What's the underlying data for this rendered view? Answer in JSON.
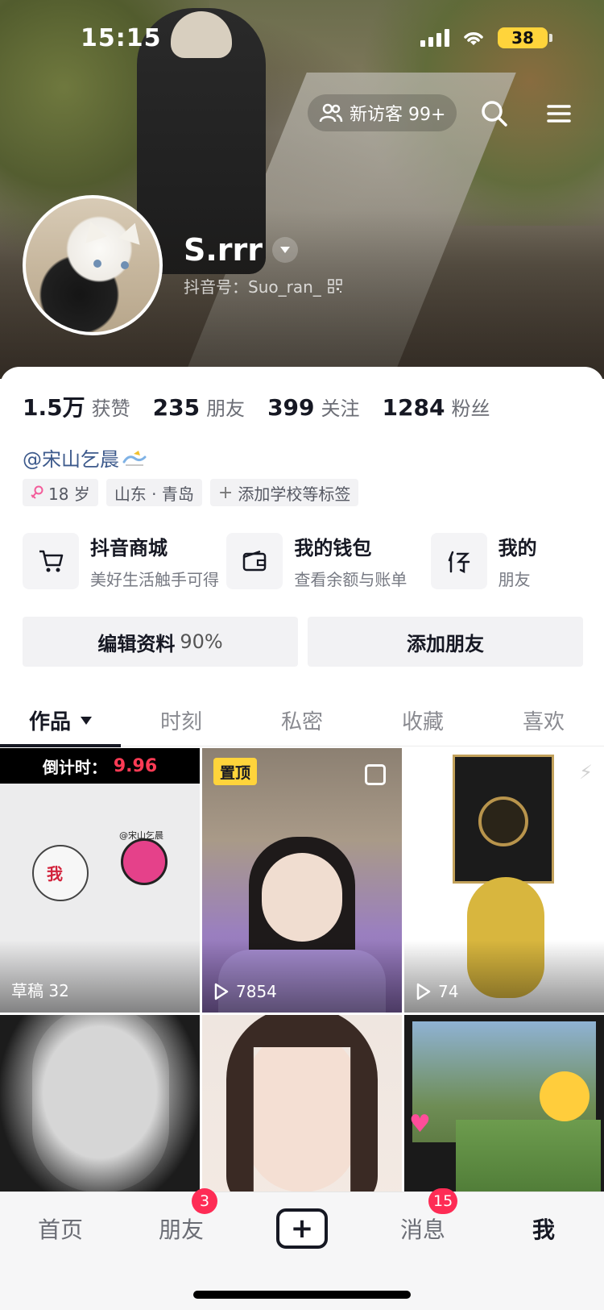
{
  "status_bar": {
    "time": "15:15",
    "battery": "38"
  },
  "header": {
    "visitor_label": "新访客 99+",
    "icons": [
      "visitors-icon",
      "search-icon",
      "menu-icon"
    ]
  },
  "profile": {
    "name": "S.rrr",
    "douyin_id": "抖音号：Suo_ran_",
    "stats": [
      {
        "num": "1.5万",
        "label": "获赞"
      },
      {
        "num": "235",
        "label": "朋友"
      },
      {
        "num": "399",
        "label": "关注"
      },
      {
        "num": "1284",
        "label": "粉丝"
      }
    ],
    "bio": "@宋山乞晨",
    "tags": [
      "18 岁",
      "山东 · 青岛",
      "添加学校等标签"
    ]
  },
  "services": [
    {
      "title": "抖音商城",
      "sub": "美好生活触手可得",
      "icon": "cart-icon"
    },
    {
      "title": "我的钱包",
      "sub": "查看余额与账单",
      "icon": "wallet-icon"
    },
    {
      "title": "我的",
      "sub": "朋友",
      "icon": "loan-icon"
    }
  ],
  "actions": {
    "edit": "编辑资料",
    "edit_pct": "90%",
    "add_friend": "添加朋友"
  },
  "tabs": [
    "作品",
    "时刻",
    "私密",
    "收藏",
    "喜欢"
  ],
  "grid": {
    "c1_countdown_label": "倒计时：",
    "c1_countdown_value": "9.96",
    "c1_tag": "@宋山乞晨",
    "c1_me": "我",
    "c1_meta": "草稿 32",
    "c2_pin": "置顶",
    "c2_views": "7854",
    "c3_views": "74"
  },
  "bottom_nav": {
    "items": [
      "首页",
      "朋友",
      "",
      "消息",
      "我"
    ],
    "friends_badge": "3",
    "messages_badge": "15"
  },
  "colors": {
    "accent": "#fe2c55",
    "pin": "#ffd43b",
    "bio_link": "#3d5a8c"
  }
}
